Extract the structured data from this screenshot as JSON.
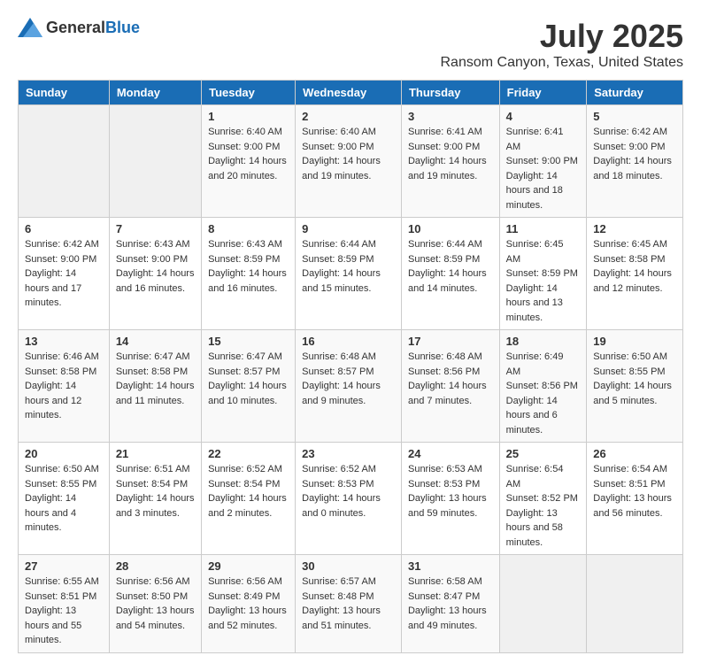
{
  "header": {
    "logo_general": "General",
    "logo_blue": "Blue",
    "month_title": "July 2025",
    "location": "Ransom Canyon, Texas, United States"
  },
  "days_of_week": [
    "Sunday",
    "Monday",
    "Tuesday",
    "Wednesday",
    "Thursday",
    "Friday",
    "Saturday"
  ],
  "weeks": [
    [
      {
        "day": "",
        "sunrise": "",
        "sunset": "",
        "daylight": ""
      },
      {
        "day": "",
        "sunrise": "",
        "sunset": "",
        "daylight": ""
      },
      {
        "day": "1",
        "sunrise": "Sunrise: 6:40 AM",
        "sunset": "Sunset: 9:00 PM",
        "daylight": "Daylight: 14 hours and 20 minutes."
      },
      {
        "day": "2",
        "sunrise": "Sunrise: 6:40 AM",
        "sunset": "Sunset: 9:00 PM",
        "daylight": "Daylight: 14 hours and 19 minutes."
      },
      {
        "day": "3",
        "sunrise": "Sunrise: 6:41 AM",
        "sunset": "Sunset: 9:00 PM",
        "daylight": "Daylight: 14 hours and 19 minutes."
      },
      {
        "day": "4",
        "sunrise": "Sunrise: 6:41 AM",
        "sunset": "Sunset: 9:00 PM",
        "daylight": "Daylight: 14 hours and 18 minutes."
      },
      {
        "day": "5",
        "sunrise": "Sunrise: 6:42 AM",
        "sunset": "Sunset: 9:00 PM",
        "daylight": "Daylight: 14 hours and 18 minutes."
      }
    ],
    [
      {
        "day": "6",
        "sunrise": "Sunrise: 6:42 AM",
        "sunset": "Sunset: 9:00 PM",
        "daylight": "Daylight: 14 hours and 17 minutes."
      },
      {
        "day": "7",
        "sunrise": "Sunrise: 6:43 AM",
        "sunset": "Sunset: 9:00 PM",
        "daylight": "Daylight: 14 hours and 16 minutes."
      },
      {
        "day": "8",
        "sunrise": "Sunrise: 6:43 AM",
        "sunset": "Sunset: 8:59 PM",
        "daylight": "Daylight: 14 hours and 16 minutes."
      },
      {
        "day": "9",
        "sunrise": "Sunrise: 6:44 AM",
        "sunset": "Sunset: 8:59 PM",
        "daylight": "Daylight: 14 hours and 15 minutes."
      },
      {
        "day": "10",
        "sunrise": "Sunrise: 6:44 AM",
        "sunset": "Sunset: 8:59 PM",
        "daylight": "Daylight: 14 hours and 14 minutes."
      },
      {
        "day": "11",
        "sunrise": "Sunrise: 6:45 AM",
        "sunset": "Sunset: 8:59 PM",
        "daylight": "Daylight: 14 hours and 13 minutes."
      },
      {
        "day": "12",
        "sunrise": "Sunrise: 6:45 AM",
        "sunset": "Sunset: 8:58 PM",
        "daylight": "Daylight: 14 hours and 12 minutes."
      }
    ],
    [
      {
        "day": "13",
        "sunrise": "Sunrise: 6:46 AM",
        "sunset": "Sunset: 8:58 PM",
        "daylight": "Daylight: 14 hours and 12 minutes."
      },
      {
        "day": "14",
        "sunrise": "Sunrise: 6:47 AM",
        "sunset": "Sunset: 8:58 PM",
        "daylight": "Daylight: 14 hours and 11 minutes."
      },
      {
        "day": "15",
        "sunrise": "Sunrise: 6:47 AM",
        "sunset": "Sunset: 8:57 PM",
        "daylight": "Daylight: 14 hours and 10 minutes."
      },
      {
        "day": "16",
        "sunrise": "Sunrise: 6:48 AM",
        "sunset": "Sunset: 8:57 PM",
        "daylight": "Daylight: 14 hours and 9 minutes."
      },
      {
        "day": "17",
        "sunrise": "Sunrise: 6:48 AM",
        "sunset": "Sunset: 8:56 PM",
        "daylight": "Daylight: 14 hours and 7 minutes."
      },
      {
        "day": "18",
        "sunrise": "Sunrise: 6:49 AM",
        "sunset": "Sunset: 8:56 PM",
        "daylight": "Daylight: 14 hours and 6 minutes."
      },
      {
        "day": "19",
        "sunrise": "Sunrise: 6:50 AM",
        "sunset": "Sunset: 8:55 PM",
        "daylight": "Daylight: 14 hours and 5 minutes."
      }
    ],
    [
      {
        "day": "20",
        "sunrise": "Sunrise: 6:50 AM",
        "sunset": "Sunset: 8:55 PM",
        "daylight": "Daylight: 14 hours and 4 minutes."
      },
      {
        "day": "21",
        "sunrise": "Sunrise: 6:51 AM",
        "sunset": "Sunset: 8:54 PM",
        "daylight": "Daylight: 14 hours and 3 minutes."
      },
      {
        "day": "22",
        "sunrise": "Sunrise: 6:52 AM",
        "sunset": "Sunset: 8:54 PM",
        "daylight": "Daylight: 14 hours and 2 minutes."
      },
      {
        "day": "23",
        "sunrise": "Sunrise: 6:52 AM",
        "sunset": "Sunset: 8:53 PM",
        "daylight": "Daylight: 14 hours and 0 minutes."
      },
      {
        "day": "24",
        "sunrise": "Sunrise: 6:53 AM",
        "sunset": "Sunset: 8:53 PM",
        "daylight": "Daylight: 13 hours and 59 minutes."
      },
      {
        "day": "25",
        "sunrise": "Sunrise: 6:54 AM",
        "sunset": "Sunset: 8:52 PM",
        "daylight": "Daylight: 13 hours and 58 minutes."
      },
      {
        "day": "26",
        "sunrise": "Sunrise: 6:54 AM",
        "sunset": "Sunset: 8:51 PM",
        "daylight": "Daylight: 13 hours and 56 minutes."
      }
    ],
    [
      {
        "day": "27",
        "sunrise": "Sunrise: 6:55 AM",
        "sunset": "Sunset: 8:51 PM",
        "daylight": "Daylight: 13 hours and 55 minutes."
      },
      {
        "day": "28",
        "sunrise": "Sunrise: 6:56 AM",
        "sunset": "Sunset: 8:50 PM",
        "daylight": "Daylight: 13 hours and 54 minutes."
      },
      {
        "day": "29",
        "sunrise": "Sunrise: 6:56 AM",
        "sunset": "Sunset: 8:49 PM",
        "daylight": "Daylight: 13 hours and 52 minutes."
      },
      {
        "day": "30",
        "sunrise": "Sunrise: 6:57 AM",
        "sunset": "Sunset: 8:48 PM",
        "daylight": "Daylight: 13 hours and 51 minutes."
      },
      {
        "day": "31",
        "sunrise": "Sunrise: 6:58 AM",
        "sunset": "Sunset: 8:47 PM",
        "daylight": "Daylight: 13 hours and 49 minutes."
      },
      {
        "day": "",
        "sunrise": "",
        "sunset": "",
        "daylight": ""
      },
      {
        "day": "",
        "sunrise": "",
        "sunset": "",
        "daylight": ""
      }
    ]
  ]
}
